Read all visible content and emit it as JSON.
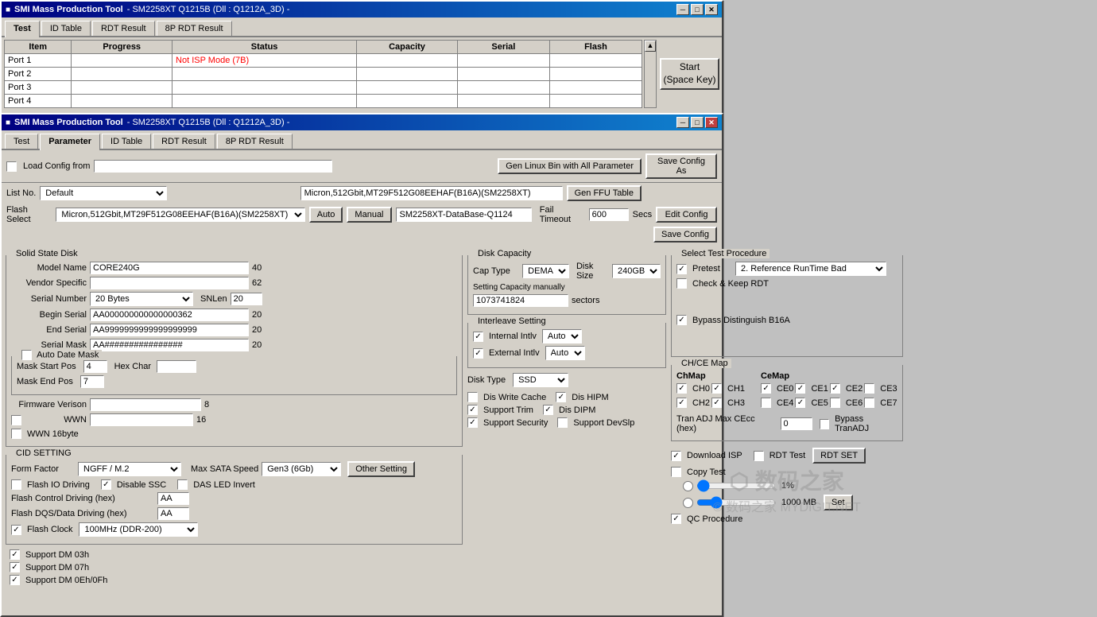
{
  "window1": {
    "title": "SMI Mass Production Tool",
    "subtitle": "- SM2258XT   Q1215B    (Dll : Q1212A_3D) -",
    "tabs": [
      "Test",
      "ID Table",
      "RDT Result",
      "8P RDT Result"
    ],
    "active_tab": "Test",
    "table": {
      "columns": [
        "Item",
        "Progress",
        "Status",
        "Capacity",
        "Serial",
        "Flash"
      ],
      "rows": [
        [
          "Port 1",
          "",
          "Not ISP Mode (7B)",
          "",
          "",
          ""
        ],
        [
          "Port 2",
          "",
          "",
          "",
          "",
          ""
        ],
        [
          "Port 3",
          "",
          "",
          "",
          "",
          ""
        ],
        [
          "Port 4",
          "",
          "",
          "",
          "",
          ""
        ]
      ]
    },
    "start_button": "Start\n(Space Key)"
  },
  "window2": {
    "title": "SMI Mass Production Tool",
    "subtitle": "- SM2258XT   Q1215B    (Dll : Q1212A_3D) -",
    "tabs": [
      "Test",
      "Parameter",
      "ID Table",
      "RDT Result",
      "8P RDT Result"
    ],
    "active_tab": "Parameter",
    "toolbar": {
      "load_config_label": "Load Config from",
      "gen_linux_btn": "Gen Linux Bin with All Parameter",
      "save_config_as_btn": "Save Config As",
      "list_no_label": "List No.",
      "list_no_value": "Default",
      "flash_info": "Micron,512Gbit,MT29F512G08EEHAF(B16A)(SM2258XT)",
      "gen_ffu_btn": "Gen FFU Table",
      "flash_select_label": "Flash Select",
      "flash_select_value": "Micron,512Gbit,MT29F512G08EEHAF(B16A)(SM2258XT)",
      "auto_btn": "Auto",
      "manual_btn": "Manual",
      "database_label": "SM2258XT-DataBase-Q1124",
      "edit_config_btn": "Edit Config",
      "fail_timeout_label": "Fail Timeout",
      "fail_timeout_value": "600",
      "secs_label": "Secs",
      "save_config_btn": "Save Config"
    },
    "solid_state_disk": {
      "group_title": "Solid State Disk",
      "model_name_label": "Model Name",
      "model_name_value": "CORE240G",
      "model_name_num": "40",
      "vendor_specific_label": "Vendor Specific",
      "vendor_specific_num": "62",
      "serial_number_label": "Serial Number",
      "serial_number_value": "20 Bytes",
      "snlen_label": "SNLen",
      "snlen_value": "20",
      "begin_serial_label": "Begin Serial",
      "begin_serial_value": "AA000000000000000362",
      "begin_serial_num": "20",
      "end_serial_label": "End Serial",
      "end_serial_value": "AA9999999999999999999",
      "end_serial_num": "20",
      "serial_mask_label": "Serial Mask",
      "serial_mask_value": "AA################",
      "serial_mask_num": "20",
      "auto_date_mask_label": "Auto Date Mask",
      "mask_start_pos_label": "Mask Start Pos",
      "mask_start_pos_value": "4",
      "hex_char_label": "Hex Char",
      "hex_char_value": "",
      "mask_end_pos_label": "Mask End Pos",
      "mask_end_pos_value": "7",
      "firmware_version_label": "Firmware Verison",
      "firmware_version_num": "8",
      "wwn_label": "WWN",
      "wwn_num": "16",
      "wwn_16byte_label": "WWN 16byte"
    },
    "disk_capacity": {
      "group_title": "Disk Capacity",
      "cap_type_label": "Cap Type",
      "cap_type_value": "DEMA",
      "disk_size_label": "Disk Size",
      "disk_size_value": "240GB",
      "setting_capacity_label": "Setting Capacity manually",
      "setting_capacity_value": "1073741824",
      "sectors_label": "sectors"
    },
    "interleave_setting": {
      "group_title": "Interleave Setting",
      "internal_intlv_label": "Internal Intlv",
      "internal_intlv_value": "Auto",
      "external_intlv_label": "External Intlv",
      "external_intlv_value": "Auto"
    },
    "disk_type": {
      "label": "Disk Type",
      "value": "SSD"
    },
    "options_left": {
      "dis_write_cache": "Dis Write Cache",
      "dis_write_cache_checked": false,
      "support_trim": "Support Trim",
      "support_trim_checked": true,
      "support_security": "Support Security",
      "support_security_checked": true,
      "dis_hipm": "Dis HIPM",
      "dis_hipm_checked": true,
      "dis_dipm": "Dis DIPM",
      "dis_dipm_checked": true,
      "support_devsip": "Support DevSlp",
      "support_devsip_checked": false
    },
    "cid_setting": {
      "group_title": "CID SETTING",
      "form_factor_label": "Form Factor",
      "form_factor_value": "NGFF / M.2",
      "max_sata_speed_label": "Max SATA Speed",
      "max_sata_speed_value": "Gen3 (6Gb)",
      "other_setting_btn": "Other Setting",
      "flash_io_driving_label": "Flash IO Driving",
      "flash_io_driving_checked": false,
      "disable_ssc_label": "Disable SSC",
      "disable_ssc_checked": true,
      "das_led_invert_label": "DAS LED Invert",
      "das_led_invert_checked": false,
      "flash_control_driving_label": "Flash Control Driving (hex)",
      "flash_control_driving_value": "AA",
      "flash_dqs_driving_label": "Flash DQS/Data Driving (hex)",
      "flash_dqs_driving_value": "AA",
      "flash_clock_label": "Flash Clock",
      "flash_clock_checked": true,
      "flash_clock_value": "100MHz (DDR-200)"
    },
    "support_dm": {
      "support_dm_03h": "Support DM 03h",
      "support_dm_03h_checked": true,
      "support_dm_07h": "Support DM 07h",
      "support_dm_07h_checked": true,
      "support_dm_0eh_0fh": "Support DM 0Eh/0Fh",
      "support_dm_0eh_0fh_checked": true
    },
    "select_test_procedure": {
      "group_title": "Select Test Procedure",
      "pretest_label": "Pretest",
      "pretest_checked": true,
      "pretest_value": "2. Reference RunTime Bad",
      "check_keep_rdt_label": "Check & Keep RDT",
      "check_keep_rdt_checked": false,
      "bypass_b16a_label": "Bypass Distinguish B16A",
      "bypass_b16a_checked": true
    },
    "ch_ce_map": {
      "group_title": "CH/CE Map",
      "ch_map_title": "ChMap",
      "ch0": "CH0",
      "ch0_checked": true,
      "ch1": "CH1",
      "ch1_checked": true,
      "ch2": "CH2",
      "ch2_checked": true,
      "ch3": "CH3",
      "ch3_checked": true,
      "ce_map_title": "CeMap",
      "ce0": "CE0",
      "ce0_checked": true,
      "ce1": "CE1",
      "ce1_checked": true,
      "ce2": "CE2",
      "ce2_checked": true,
      "ce3": "CE3",
      "ce3_checked": false,
      "ce4": "CE4",
      "ce4_checked": false,
      "ce5": "CE5",
      "ce5_checked": true,
      "ce6": "CE6",
      "ce6_checked": false,
      "ce7": "CE7",
      "ce7_checked": false,
      "tran_adj_label": "Tran ADJ Max CEcc (hex)",
      "tran_adj_value": "0",
      "bypass_tranadj_label": "Bypass TranADJ",
      "bypass_tranadj_checked": false
    },
    "bottom_controls": {
      "download_isp_label": "Download ISP",
      "download_isp_checked": true,
      "rdt_test_label": "RDT Test",
      "rdt_test_checked": false,
      "rdt_set_btn": "RDT SET",
      "copy_test_label": "Copy Test",
      "copy_test_checked": false,
      "progress_pct": "1%",
      "size_mb": "1000 MB",
      "set_btn": "Set",
      "qc_procedure_label": "QC Procedure",
      "qc_procedure_checked": true
    },
    "watermark": "© 数码之家 MYDIGIT.NET"
  },
  "icons": {
    "minimize": "─",
    "maximize": "□",
    "close": "✕",
    "app_icon": "■",
    "checkbox_check": "✓"
  }
}
